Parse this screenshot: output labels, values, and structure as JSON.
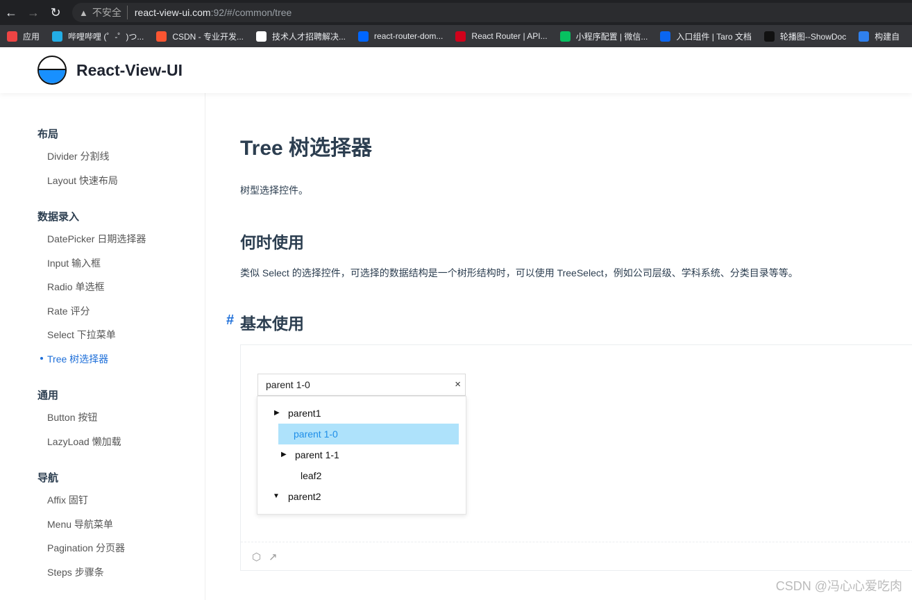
{
  "browser": {
    "insecure": "不安全",
    "host": "react-view-ui.com",
    "path": ":92/#/common/tree",
    "bookmarks": [
      {
        "label": "应用",
        "color": "#e44"
      },
      {
        "label": "哔哩哔哩 (゜-゜)つ...",
        "color": "#23ade5"
      },
      {
        "label": "CSDN - 专业开发...",
        "color": "#fc5531"
      },
      {
        "label": "技术人才招聘解决...",
        "color": "#fff"
      },
      {
        "label": "react-router-dom...",
        "color": "#0066ff"
      },
      {
        "label": "React Router | API...",
        "color": "#d0021b"
      },
      {
        "label": "小程序配置 | 微信...",
        "color": "#07c160"
      },
      {
        "label": "入口组件 | Taro 文档",
        "color": "#0b66f0"
      },
      {
        "label": "轮播图--ShowDoc",
        "color": "#111"
      },
      {
        "label": "构建自",
        "color": "#2f80ed"
      }
    ]
  },
  "header": {
    "brand": "React-View-UI"
  },
  "sidebar": {
    "groups": [
      {
        "title": "布局",
        "items": [
          "Divider 分割线",
          "Layout 快速布局"
        ]
      },
      {
        "title": "数据录入",
        "items": [
          "DatePicker 日期选择器",
          "Input 输入框",
          "Radio 单选框",
          "Rate 评分",
          "Select 下拉菜单",
          "Tree 树选择器"
        ]
      },
      {
        "title": "通用",
        "items": [
          "Button 按钮",
          "LazyLoad 懒加载"
        ]
      },
      {
        "title": "导航",
        "items": [
          "Affix 固钉",
          "Menu 导航菜单",
          "Pagination 分页器",
          "Steps 步骤条"
        ]
      }
    ],
    "active": "Tree 树选择器"
  },
  "main": {
    "title": "Tree 树选择器",
    "desc": "树型选择控件。",
    "when_title": "何时使用",
    "when_desc": "类似 Select 的选择控件，可选择的数据结构是一个树形结构时，可以使用 TreeSelect，例如公司层级、学科系统、分类目录等等。",
    "basic_title": "基本使用",
    "hash": "#",
    "select": {
      "value": "parent 1-0",
      "clear": "×"
    },
    "tree": [
      "parent1",
      "parent 1-0",
      "parent 1-1",
      "leaf2",
      "parent2"
    ],
    "accent": "#1e6fd9",
    "highlight": "#aee2fb"
  },
  "watermark": "CSDN @冯心心爱吃肉"
}
